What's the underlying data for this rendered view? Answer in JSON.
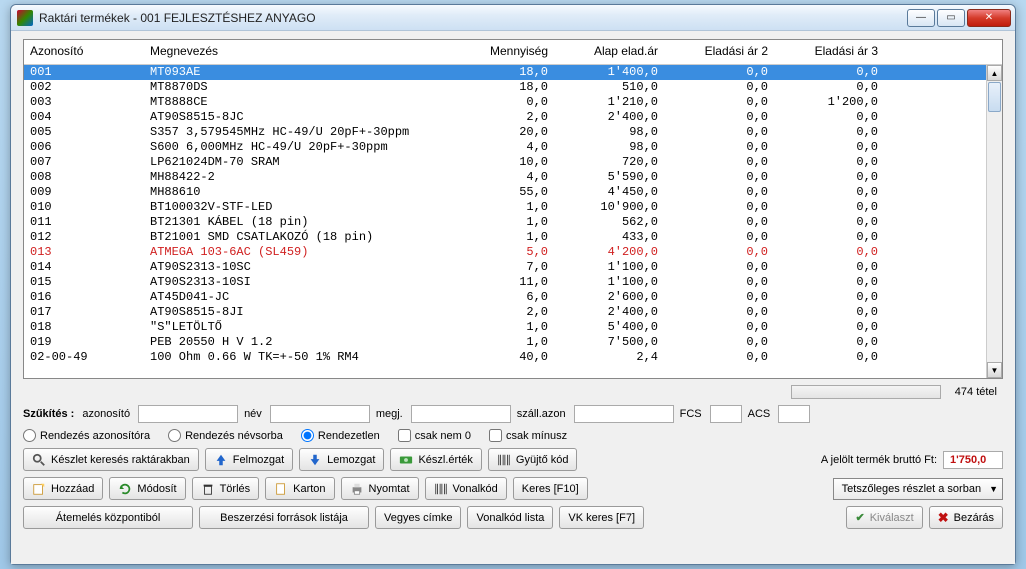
{
  "window": {
    "title": "Raktári termékek - 001 FEJLESZTÉSHEZ ANYAGO"
  },
  "columns": {
    "c1": "Azonosító",
    "c2": "Megnevezés",
    "c3": "Mennyiség",
    "c4": "Alap elad.ár",
    "c5": "Eladási ár 2",
    "c6": "Eladási ár 3"
  },
  "rows": [
    {
      "id": "001",
      "name": "MT093AE",
      "qty": "18,0",
      "p1": "1'400,0",
      "p2": "0,0",
      "p3": "0,0",
      "sel": true
    },
    {
      "id": "002",
      "name": "MT8870DS",
      "qty": "18,0",
      "p1": "510,0",
      "p2": "0,0",
      "p3": "0,0"
    },
    {
      "id": "003",
      "name": "MT8888CE",
      "qty": "0,0",
      "p1": "1'210,0",
      "p2": "0,0",
      "p3": "1'200,0"
    },
    {
      "id": "004",
      "name": "AT90S8515-8JC",
      "qty": "2,0",
      "p1": "2'400,0",
      "p2": "0,0",
      "p3": "0,0"
    },
    {
      "id": "005",
      "name": "S357 3,579545MHz HC-49/U 20pF+-30ppm",
      "qty": "20,0",
      "p1": "98,0",
      "p2": "0,0",
      "p3": "0,0"
    },
    {
      "id": "006",
      "name": "S600 6,000MHz HC-49/U 20pF+-30ppm",
      "qty": "4,0",
      "p1": "98,0",
      "p2": "0,0",
      "p3": "0,0"
    },
    {
      "id": "007",
      "name": "LP621024DM-70 SRAM",
      "qty": "10,0",
      "p1": "720,0",
      "p2": "0,0",
      "p3": "0,0"
    },
    {
      "id": "008",
      "name": "MH88422-2",
      "qty": "4,0",
      "p1": "5'590,0",
      "p2": "0,0",
      "p3": "0,0"
    },
    {
      "id": "009",
      "name": "MH88610",
      "qty": "55,0",
      "p1": "4'450,0",
      "p2": "0,0",
      "p3": "0,0"
    },
    {
      "id": "010",
      "name": "BT100032V-STF-LED",
      "qty": "1,0",
      "p1": "10'900,0",
      "p2": "0,0",
      "p3": "0,0"
    },
    {
      "id": "011",
      "name": "BT21301 KÁBEL (18 pin)",
      "qty": "1,0",
      "p1": "562,0",
      "p2": "0,0",
      "p3": "0,0"
    },
    {
      "id": "012",
      "name": "BT21001 SMD CSATLAKOZÓ (18 pin)",
      "qty": "1,0",
      "p1": "433,0",
      "p2": "0,0",
      "p3": "0,0"
    },
    {
      "id": "013",
      "name": "ATMEGA 103-6AC (SL459)",
      "qty": "5,0",
      "p1": "4'200,0",
      "p2": "0,0",
      "p3": "0,0",
      "red": true
    },
    {
      "id": "014",
      "name": "AT90S2313-10SC",
      "qty": "7,0",
      "p1": "1'100,0",
      "p2": "0,0",
      "p3": "0,0"
    },
    {
      "id": "015",
      "name": "AT90S2313-10SI",
      "qty": "11,0",
      "p1": "1'100,0",
      "p2": "0,0",
      "p3": "0,0"
    },
    {
      "id": "016",
      "name": "AT45D041-JC",
      "qty": "6,0",
      "p1": "2'600,0",
      "p2": "0,0",
      "p3": "0,0"
    },
    {
      "id": "017",
      "name": "AT90S8515-8JI",
      "qty": "2,0",
      "p1": "2'400,0",
      "p2": "0,0",
      "p3": "0,0"
    },
    {
      "id": "018",
      "name": "\"S\"LETÖLTŐ",
      "qty": "1,0",
      "p1": "5'400,0",
      "p2": "0,0",
      "p3": "0,0"
    },
    {
      "id": "019",
      "name": "PEB 20550 H V 1.2",
      "qty": "1,0",
      "p1": "7'500,0",
      "p2": "0,0",
      "p3": "0,0"
    },
    {
      "id": "02-00-49",
      "name": "100 Ohm 0.66 W TK=+-50 1% RM4",
      "qty": "40,0",
      "p1": "2,4",
      "p2": "0,0",
      "p3": "0,0"
    }
  ],
  "count": "474 tétel",
  "filter": {
    "label": "Szűkítés :",
    "id_label": "azonosító",
    "name_label": "név",
    "note_label": "megj.",
    "supplier_label": "száll.azon",
    "fcs": "FCS",
    "acs": "ACS"
  },
  "sort": {
    "by_id": "Rendezés azonosítóra",
    "by_name": "Rendezés névsorba",
    "unsorted": "Rendezetlen",
    "only_nonzero": "csak nem 0",
    "only_minus": "csak mínusz"
  },
  "buttons": {
    "stock_search": "Készlet keresés raktárakban",
    "move_up": "Felmozgat",
    "move_down": "Lemozgat",
    "stock_value": "Készl.érték",
    "collector": "Gyüjtő kód",
    "add": "Hozzáad",
    "modify": "Módosít",
    "delete": "Törlés",
    "card": "Karton",
    "print": "Nyomtat",
    "barcode": "Vonalkód",
    "search": "Keres [F10]",
    "transfer": "Átemelés központiból",
    "purchase": "Beszerzési források listája",
    "misc_label": "Vegyes címke",
    "barcode_list": "Vonalkód lista",
    "vk_search": "VK keres [F7]",
    "select": "Kiválaszt",
    "close": "Bezárás"
  },
  "gross": {
    "label": "A jelölt termék bruttó Ft:",
    "value": "1'750,0"
  },
  "combo": {
    "label": "Tetszőleges részlet a sorban"
  }
}
